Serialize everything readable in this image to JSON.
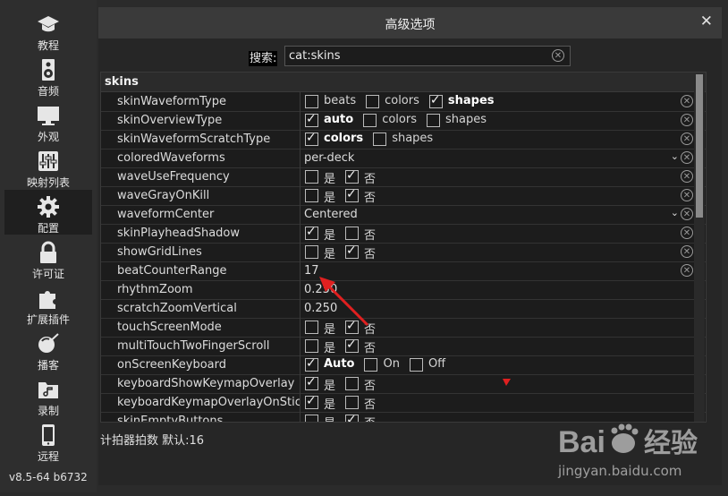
{
  "sidebar": {
    "items": [
      {
        "label": "教程",
        "icon": "graduation-cap-icon"
      },
      {
        "label": "音频",
        "icon": "speaker-icon"
      },
      {
        "label": "外观",
        "icon": "monitor-icon"
      },
      {
        "label": "映射列表",
        "icon": "sliders-icon"
      },
      {
        "label": "配置",
        "icon": "gear-icon"
      },
      {
        "label": "许可证",
        "icon": "lock-icon"
      },
      {
        "label": "扩展插件",
        "icon": "puzzle-icon"
      },
      {
        "label": "播客",
        "icon": "podcast-icon"
      },
      {
        "label": "录制",
        "icon": "music-folder-icon"
      },
      {
        "label": "远程",
        "icon": "phone-icon"
      }
    ],
    "active": "配置",
    "version": "v8.5-64 b6732"
  },
  "dialog": {
    "title": "高级选项",
    "close_symbol": "✕",
    "search_label": "搜索:",
    "search_value": "cat:skins",
    "section": "skins",
    "footer": "计拍器拍数 默认:16"
  },
  "rows": [
    {
      "key": "skinWaveformType",
      "type": "checks",
      "options": [
        {
          "label": "beats",
          "checked": false
        },
        {
          "label": "colors",
          "checked": false
        },
        {
          "label": "shapes",
          "checked": true
        }
      ]
    },
    {
      "key": "skinOverviewType",
      "type": "checks",
      "options": [
        {
          "label": "auto",
          "checked": true
        },
        {
          "label": "colors",
          "checked": false
        },
        {
          "label": "shapes",
          "checked": false
        }
      ]
    },
    {
      "key": "skinWaveformScratchType",
      "type": "checks",
      "options": [
        {
          "label": "colors",
          "checked": true
        },
        {
          "label": "shapes",
          "checked": false
        }
      ]
    },
    {
      "key": "coloredWaveforms",
      "type": "dropdown",
      "value": "per-deck"
    },
    {
      "key": "waveUseFrequency",
      "type": "checks",
      "options": [
        {
          "label": "是",
          "checked": false
        },
        {
          "label": "否",
          "checked": true
        }
      ]
    },
    {
      "key": "waveGrayOnKill",
      "type": "checks",
      "options": [
        {
          "label": "是",
          "checked": false
        },
        {
          "label": "否",
          "checked": true
        }
      ]
    },
    {
      "key": "waveformCenter",
      "type": "dropdown",
      "value": "Centered"
    },
    {
      "key": "skinPlayheadShadow",
      "type": "checks",
      "options": [
        {
          "label": "是",
          "checked": true
        },
        {
          "label": "否",
          "checked": false
        }
      ]
    },
    {
      "key": "showGridLines",
      "type": "checks",
      "options": [
        {
          "label": "是",
          "checked": false
        },
        {
          "label": "否",
          "checked": true
        }
      ]
    },
    {
      "key": "beatCounterRange",
      "type": "text",
      "value": "17"
    },
    {
      "key": "rhythmZoom",
      "type": "text",
      "value": "0.250",
      "noclear": true
    },
    {
      "key": "scratchZoomVertical",
      "type": "text",
      "value": "0.250",
      "noclear": true
    },
    {
      "key": "touchScreenMode",
      "type": "checks",
      "options": [
        {
          "label": "是",
          "checked": false
        },
        {
          "label": "否",
          "checked": true
        }
      ],
      "noclear": true
    },
    {
      "key": "multiTouchTwoFingerScroll",
      "type": "checks",
      "options": [
        {
          "label": "是",
          "checked": false
        },
        {
          "label": "否",
          "checked": true
        }
      ],
      "noclear": true
    },
    {
      "key": "onScreenKeyboard",
      "type": "checks",
      "options": [
        {
          "label": "Auto",
          "checked": true
        },
        {
          "label": "On",
          "checked": false
        },
        {
          "label": "Off",
          "checked": false
        }
      ],
      "noclear": true
    },
    {
      "key": "keyboardShowKeymapOverlay",
      "type": "checks",
      "options": [
        {
          "label": "是",
          "checked": true
        },
        {
          "label": "否",
          "checked": false
        }
      ],
      "noclear": true
    },
    {
      "key": "keyboardKeymapOverlayOnStic",
      "type": "checks",
      "options": [
        {
          "label": "是",
          "checked": true
        },
        {
          "label": "否",
          "checked": false
        }
      ],
      "noclear": true
    },
    {
      "key": "skinEmptyButtons",
      "type": "checks",
      "options": [
        {
          "label": "是",
          "checked": false
        },
        {
          "label": "否",
          "checked": true
        }
      ],
      "noclear": true
    }
  ],
  "watermark": {
    "brand": "Bai",
    "brand2": "经验",
    "url": "jingyan.baidu.com"
  },
  "colors": {
    "annotation_red": "#e02020",
    "background": "#2b2b2b",
    "table": "#1c1c1c"
  }
}
